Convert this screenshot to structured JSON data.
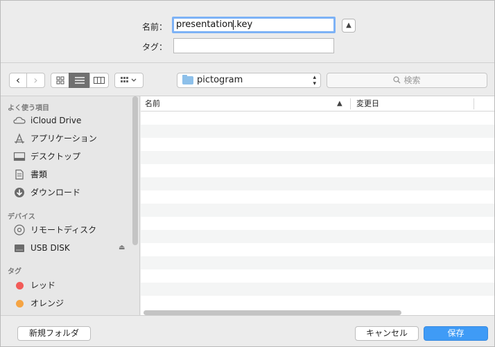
{
  "form": {
    "name_label": "名前：",
    "name_value_before": "presentation",
    "name_value_after": ".key",
    "tag_label": "タグ：",
    "tag_value": ""
  },
  "toolbar": {
    "back": "‹",
    "forward": "›",
    "path_folder": "pictogram",
    "search_placeholder": "検索"
  },
  "sidebar": {
    "sections": [
      {
        "title": "よく使う項目",
        "items": [
          {
            "label": "iCloud Drive",
            "icon": "cloud-icon"
          },
          {
            "label": "アプリケーション",
            "icon": "applications-icon"
          },
          {
            "label": "デスクトップ",
            "icon": "desktop-icon"
          },
          {
            "label": "書類",
            "icon": "documents-icon"
          },
          {
            "label": "ダウンロード",
            "icon": "downloads-icon"
          }
        ]
      },
      {
        "title": "デバイス",
        "items": [
          {
            "label": "リモートディスク",
            "icon": "disc-icon"
          },
          {
            "label": "USB DISK",
            "icon": "drive-icon"
          }
        ]
      },
      {
        "title": "タグ",
        "items": [
          {
            "label": "レッド",
            "color": "#f25b58"
          },
          {
            "label": "オレンジ",
            "color": "#f5a443"
          }
        ]
      }
    ]
  },
  "filelist": {
    "columns": {
      "name": "名前",
      "date": "変更日"
    }
  },
  "buttons": {
    "new_folder": "新規フォルダ",
    "cancel": "キャンセル",
    "save": "保存"
  },
  "colors": {
    "accent": "#3f9bf6",
    "focus_ring": "#7db2f6"
  }
}
